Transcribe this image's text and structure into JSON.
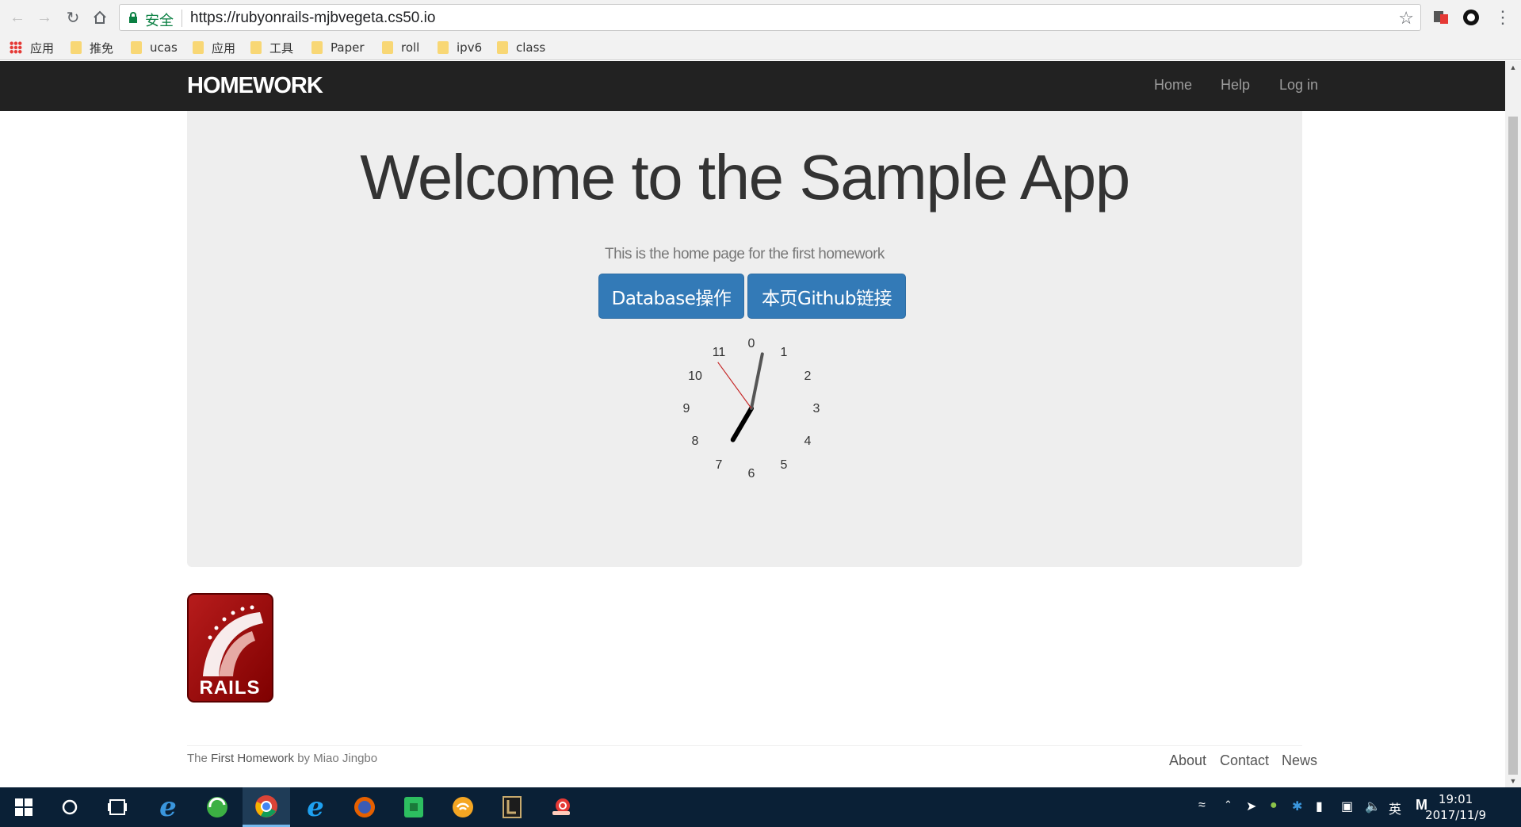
{
  "browser": {
    "secure_label": "安全",
    "url": "https://rubyonrails-mjbvegeta.cs50.io",
    "bookmarks": [
      {
        "label": "应用",
        "kind": "apps"
      },
      {
        "label": "推免",
        "kind": "folder"
      },
      {
        "label": "ucas",
        "kind": "folder"
      },
      {
        "label": "应用",
        "kind": "folder"
      },
      {
        "label": "工具",
        "kind": "folder"
      },
      {
        "label": "Paper",
        "kind": "folder"
      },
      {
        "label": "roll",
        "kind": "folder"
      },
      {
        "label": "ipv6",
        "kind": "folder"
      },
      {
        "label": "class",
        "kind": "folder"
      }
    ]
  },
  "navbar": {
    "brand": "HOMEWORK",
    "links": [
      "Home",
      "Help",
      "Log in"
    ]
  },
  "jumbotron": {
    "title": "Welcome to the Sample App",
    "subtitle": "This is the home page for the first homework",
    "buttons": [
      "Database操作",
      "本页Github链接"
    ]
  },
  "clock": {
    "numbers": [
      "0",
      "1",
      "2",
      "3",
      "4",
      "5",
      "6",
      "7",
      "8",
      "9",
      "10",
      "11"
    ],
    "time": {
      "hour": 7,
      "minute": 1,
      "second": 54
    }
  },
  "logo": {
    "text": "RAILS"
  },
  "footer": {
    "prefix": "The ",
    "strong": "First Homework",
    "suffix": " by Miao Jingbo",
    "links": [
      "About",
      "Contact",
      "News"
    ]
  },
  "taskbar": {
    "ime": "英",
    "time": "19:01",
    "date": "2017/11/9"
  },
  "colors": {
    "navbar_bg": "#222222",
    "jumbotron_bg": "#eeeeee",
    "button_primary": "#337ab7",
    "taskbar_bg": "#0a2036"
  }
}
